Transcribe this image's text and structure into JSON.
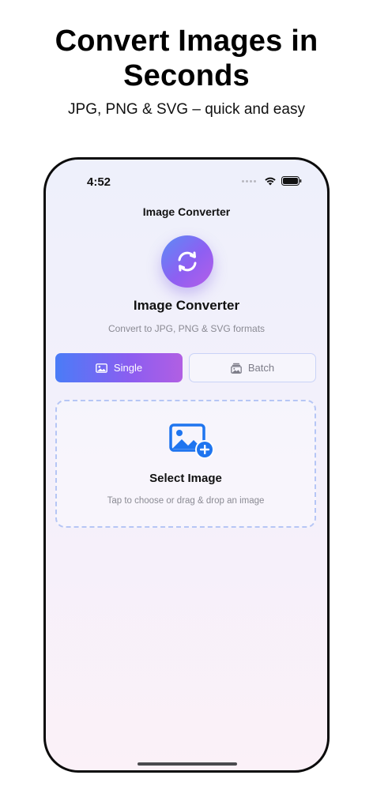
{
  "promo": {
    "title_line1": "Convert Images in",
    "title_line2": "Seconds",
    "subtitle": "JPG, PNG & SVG – quick and easy"
  },
  "status_bar": {
    "time": "4:52"
  },
  "nav": {
    "title": "Image Converter"
  },
  "header": {
    "logo_icon": "refresh-icon",
    "title": "Image Converter",
    "subtitle": "Convert to JPG, PNG & SVG formats"
  },
  "mode_selector": {
    "selected": "Single",
    "options": [
      {
        "label": "Single",
        "icon": "image-icon"
      },
      {
        "label": "Batch",
        "icon": "stack-images-icon"
      }
    ]
  },
  "dropzone": {
    "icon": "add-image-icon",
    "title": "Select Image",
    "subtitle": "Tap to choose or drag & drop an image"
  },
  "colors": {
    "accent_start": "#4a7cf7",
    "accent_end": "#b15fe3",
    "dropzone_icon": "#1f75ef",
    "dropzone_border": "#b6c6f5"
  }
}
